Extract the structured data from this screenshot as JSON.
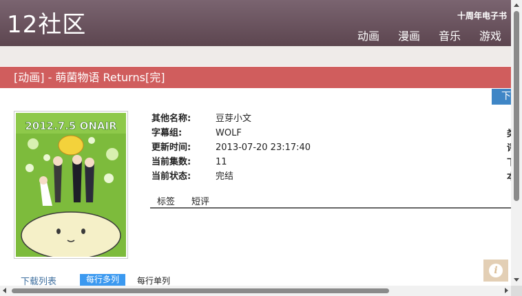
{
  "header": {
    "logo": "12社区",
    "anniversary_link": "十周年电子书",
    "nav": [
      "动画",
      "漫画",
      "音乐",
      "游戏"
    ]
  },
  "title_bar": {
    "title": "[动画] - 萌菌物语 Returns[完]"
  },
  "download_button": "下",
  "poster": {
    "banner_text": "2012.7.5 ONAIR"
  },
  "info": {
    "rows": [
      {
        "label": "其他名称:",
        "value": "豆芽小文"
      },
      {
        "label": "字幕组:",
        "value": "WOLF"
      },
      {
        "label": "更新时间:",
        "value": "2013-07-20 23:17:40"
      },
      {
        "label": "当前集数:",
        "value": "11"
      },
      {
        "label": "当前状态:",
        "value": "完结"
      }
    ],
    "right_column_cut": [
      "类",
      "评",
      "下",
      "本"
    ]
  },
  "tabs": [
    "标签",
    "短评"
  ],
  "download_list": {
    "title": "下载列表",
    "layout_multi": "每行多列",
    "layout_single": "每行单列"
  },
  "info_fab": "i",
  "colors": {
    "header_bg": "#6b5560",
    "title_bar_bg": "#d05d5d",
    "accent_blue": "#3b99f0",
    "link_blue": "#3f6f9f"
  }
}
